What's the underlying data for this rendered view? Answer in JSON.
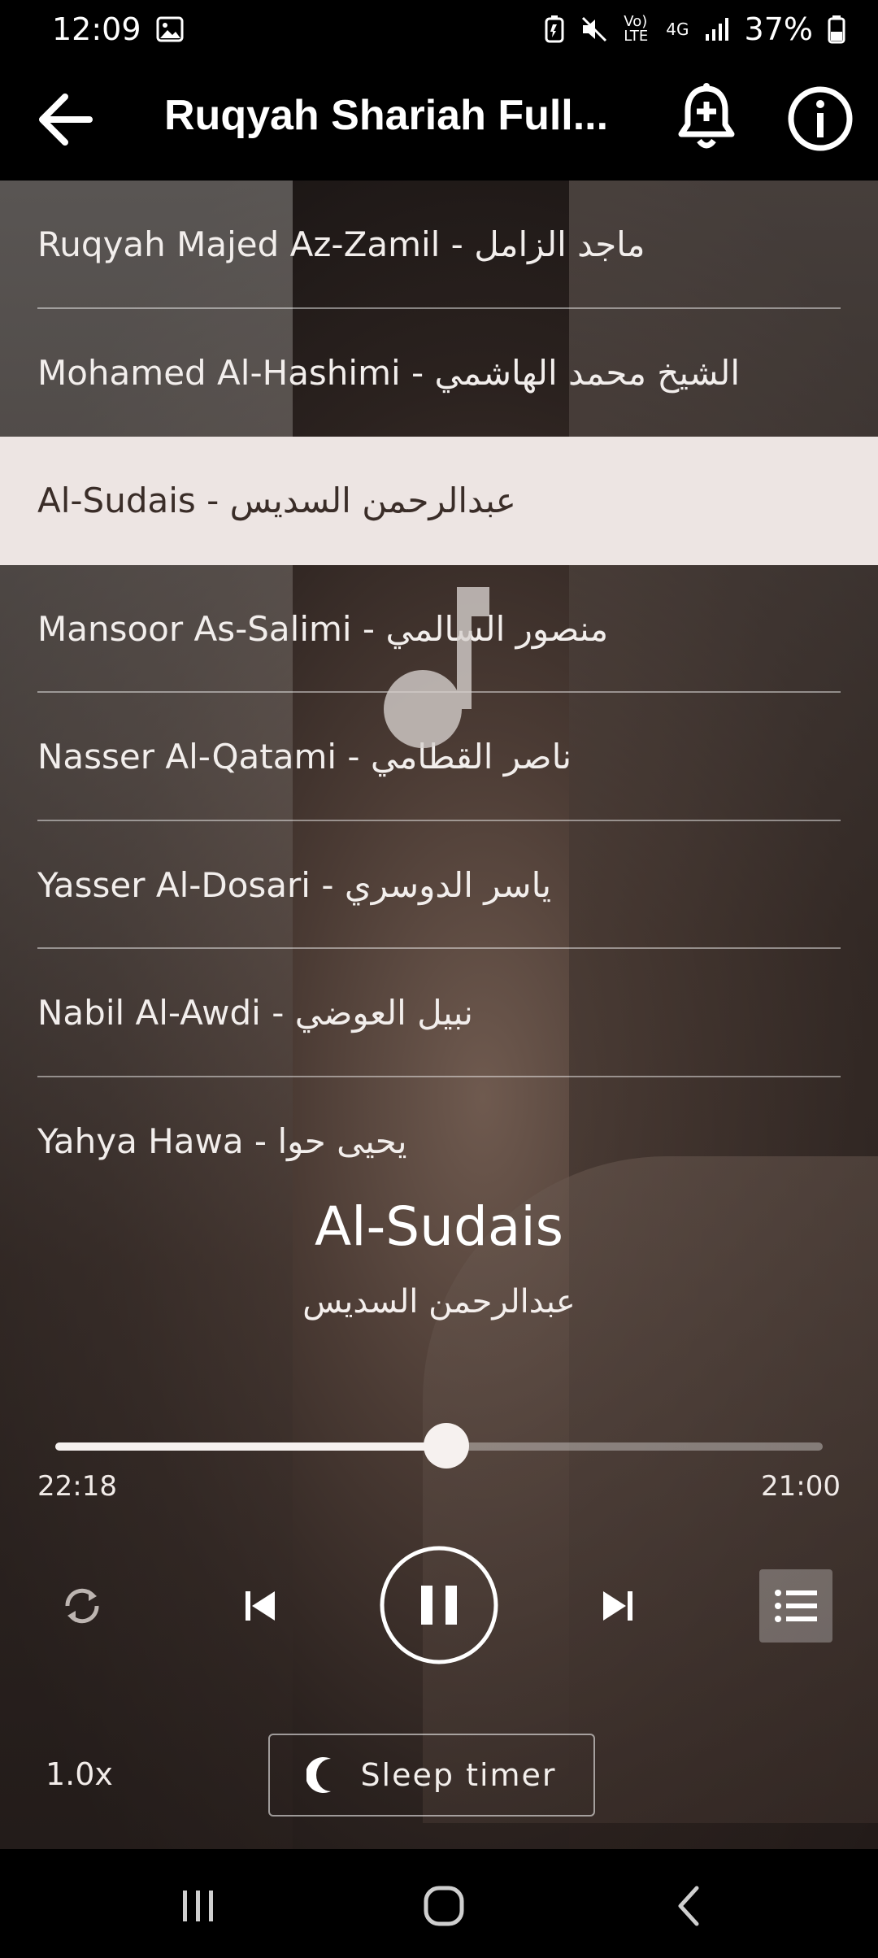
{
  "status": {
    "time": "12:09",
    "battery": "37%",
    "network": "4G",
    "volte": "Vo) LTE"
  },
  "app_bar": {
    "title": "Ruqyah Shariah Full..."
  },
  "reciters": [
    {
      "label": "Ruqyah Majed Az-Zamil - ماجد الزامل"
    },
    {
      "label": "Mohamed Al-Hashimi - الشيخ محمد الهاشمي"
    },
    {
      "label": "Al-Sudais - عبدالرحمن السديس",
      "selected": true
    },
    {
      "label": "Mansoor As-Salimi - منصور السالمي"
    },
    {
      "label": "Nasser Al-Qatami - ناصر القطامي"
    },
    {
      "label": "Yasser Al-Dosari - ياسر الدوسري"
    },
    {
      "label": "Nabil Al-Awdi - نبيل العوضي"
    },
    {
      "label": "Yahya Hawa - يحيى حوا"
    }
  ],
  "now_playing": {
    "title": "Al-Sudais",
    "subtitle": "عبدالرحمن السديس"
  },
  "progress": {
    "elapsed": "22:18",
    "duration": "21:00",
    "fraction": 0.51
  },
  "controls": {
    "speed": "1.0x",
    "sleep_timer": "Sleep timer"
  },
  "icons": {
    "back": "arrow-left-icon",
    "bell": "bell-plus-icon",
    "info": "info-icon",
    "repeat": "repeat-icon",
    "previous": "skip-previous-icon",
    "pause": "pause-icon",
    "next": "skip-next-icon",
    "playlist": "playlist-icon",
    "moon": "moon-icon"
  },
  "colors": {
    "selected_row": "#ede5e3",
    "text": "#ffffff",
    "bar": "#000000"
  }
}
